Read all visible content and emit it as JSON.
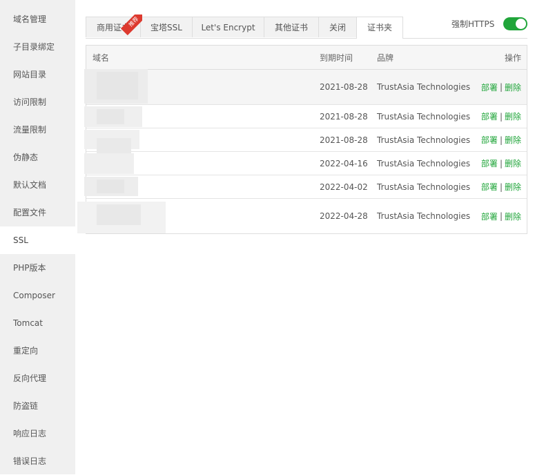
{
  "sidebar": {
    "items": [
      {
        "label": "域名管理",
        "active": false
      },
      {
        "label": "子目录绑定",
        "active": false
      },
      {
        "label": "网站目录",
        "active": false
      },
      {
        "label": "访问限制",
        "active": false
      },
      {
        "label": "流量限制",
        "active": false
      },
      {
        "label": "伪静态",
        "active": false
      },
      {
        "label": "默认文档",
        "active": false
      },
      {
        "label": "配置文件",
        "active": false
      },
      {
        "label": "SSL",
        "active": true
      },
      {
        "label": "PHP版本",
        "active": false
      },
      {
        "label": "Composer",
        "active": false
      },
      {
        "label": "Tomcat",
        "active": false
      },
      {
        "label": "重定向",
        "active": false
      },
      {
        "label": "反向代理",
        "active": false
      },
      {
        "label": "防盗链",
        "active": false
      },
      {
        "label": "响应日志",
        "active": false
      },
      {
        "label": "错误日志",
        "active": false
      }
    ]
  },
  "tabs": [
    {
      "label": "商用证书",
      "badge": "推荐",
      "active": false
    },
    {
      "label": "宝塔SSL",
      "active": false
    },
    {
      "label": "Let's Encrypt",
      "active": false
    },
    {
      "label": "其他证书",
      "active": false
    },
    {
      "label": "关闭",
      "active": false
    },
    {
      "label": "证书夹",
      "active": true
    }
  ],
  "https_toggle": {
    "label": "强制HTTPS",
    "enabled": true
  },
  "table": {
    "headers": {
      "domain": "域名",
      "expiry": "到期时间",
      "brand": "品牌",
      "actions": "操作"
    },
    "rows": [
      {
        "domain": "",
        "expiry": "2021-08-28",
        "brand": "TrustAsia Technologies",
        "deploy": "部署",
        "delete": "删除"
      },
      {
        "domain": "",
        "expiry": "2021-08-28",
        "brand": "TrustAsia Technologies",
        "deploy": "部署",
        "delete": "删除"
      },
      {
        "domain": "",
        "expiry": "2021-08-28",
        "brand": "TrustAsia Technologies",
        "deploy": "部署",
        "delete": "删除"
      },
      {
        "domain": "",
        "expiry": "2022-04-16",
        "brand": "TrustAsia Technologies",
        "deploy": "部署",
        "delete": "删除"
      },
      {
        "domain": "",
        "expiry": "2022-04-02",
        "brand": "TrustAsia Technologies",
        "deploy": "部署",
        "delete": "删除"
      },
      {
        "domain": "",
        "expiry": "2022-04-28",
        "brand": "TrustAsia Technologies",
        "deploy": "部署",
        "delete": "删除"
      }
    ],
    "separator": "|"
  },
  "colors": {
    "accent": "#20a53a",
    "badge": "#dd3a2f",
    "sidebar_bg": "#f0f0f0"
  }
}
